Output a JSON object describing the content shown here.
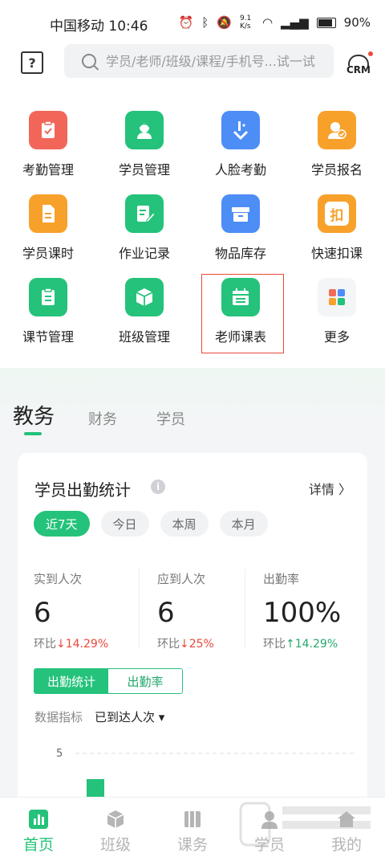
{
  "status": {
    "carrier": "中国移动 10:46",
    "net_speed": "9.1 K/s",
    "battery": "90%"
  },
  "search": {
    "placeholder": "学员/老师/班级/课程/手机号...试一试"
  },
  "crm_label": "CRM",
  "help_icon": "?",
  "grid": [
    {
      "label": "考勤管理",
      "color": "#f2665a",
      "icon": "clipboard-check-icon"
    },
    {
      "label": "学员管理",
      "color": "#24c27a",
      "icon": "student-icon"
    },
    {
      "label": "人脸考勤",
      "color": "#4d8df6",
      "icon": "face-check-icon"
    },
    {
      "label": "学员报名",
      "color": "#f7a12b",
      "icon": "enroll-icon"
    },
    {
      "label": "学员课时",
      "color": "#f7a12b",
      "icon": "document-icon"
    },
    {
      "label": "作业记录",
      "color": "#24c27a",
      "icon": "homework-icon"
    },
    {
      "label": "物品库存",
      "color": "#4d8df6",
      "icon": "box-icon"
    },
    {
      "label": "快速扣课",
      "color": "#f7a12b",
      "icon": "deduct-icon",
      "glyph": "扣"
    },
    {
      "label": "课节管理",
      "color": "#24c27a",
      "icon": "lesson-icon"
    },
    {
      "label": "班级管理",
      "color": "#24c27a",
      "icon": "cube-icon"
    },
    {
      "label": "老师课表",
      "color": "#24c27a",
      "icon": "calendar-icon",
      "highlighted": true
    },
    {
      "label": "更多",
      "color": "#f4f5f7",
      "icon": "more-apps-icon"
    }
  ],
  "tabs": [
    {
      "label": "教务",
      "active": true
    },
    {
      "label": "财务",
      "active": false
    },
    {
      "label": "学员",
      "active": false
    }
  ],
  "card": {
    "title": "学员出勤统计",
    "info_icon": "i",
    "detail": "详情 〉",
    "chips": [
      "近7天",
      "今日",
      "本周",
      "本月"
    ],
    "stats": [
      {
        "label": "实到人次",
        "value": "6",
        "cmp_label": "环比",
        "arrow": "↓",
        "cmp": "14.29%",
        "trend": "down"
      },
      {
        "label": "应到人次",
        "value": "6",
        "cmp_label": "环比",
        "arrow": "↓",
        "cmp": "25%",
        "trend": "down"
      },
      {
        "label": "出勤率",
        "value": "100%",
        "cmp_label": "环比",
        "arrow": "↑",
        "cmp": "14.29%",
        "trend": "up"
      }
    ],
    "segments": [
      "出勤统计",
      "出勤率"
    ],
    "metric_label": "数据指标",
    "metric_value": "已到达人次 ▾"
  },
  "chart_data": {
    "type": "bar",
    "y_ticks": [
      "5"
    ],
    "bar_color": "#24c27a"
  },
  "bottom_nav": [
    {
      "label": "首页",
      "active": true
    },
    {
      "label": "班级",
      "active": false
    },
    {
      "label": "课务",
      "active": false
    },
    {
      "label": "学员",
      "active": false
    },
    {
      "label": "我的",
      "active": false
    }
  ],
  "accent": "#24c27a"
}
